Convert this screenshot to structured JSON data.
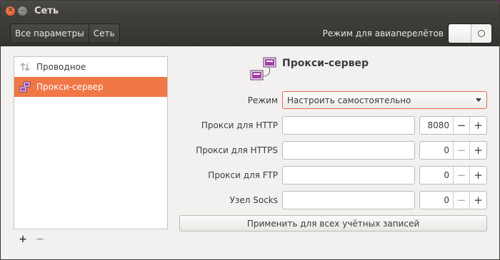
{
  "window": {
    "title": "Сеть"
  },
  "toolbar": {
    "breadcrumbs": [
      "Все параметры",
      "Сеть"
    ],
    "airplane_label": "Режим для авиаперелётов",
    "airplane_mode": "off"
  },
  "sidebar": {
    "items": [
      {
        "label": "Проводное",
        "icon": "wired-network-icon",
        "selected": false
      },
      {
        "label": "Прокси-сервер",
        "icon": "proxy-server-icon",
        "selected": true
      }
    ],
    "add_label": "+",
    "remove_label": "−"
  },
  "proxy": {
    "title": "Прокси-сервер",
    "mode_label": "Режим",
    "mode_value": "Настроить самостоятельно",
    "rows": [
      {
        "label": "Прокси для HTTP",
        "host": "",
        "port": "8080"
      },
      {
        "label": "Прокси для HTTPS",
        "host": "",
        "port": "0"
      },
      {
        "label": "Прокси для FTP",
        "host": "",
        "port": "0"
      },
      {
        "label": "Узел Socks",
        "host": "",
        "port": "0"
      }
    ],
    "stepper_minus": "−",
    "stepper_plus": "+",
    "apply_label": "Применить для всех учётных записей"
  },
  "colors": {
    "accent": "#f07746",
    "titlebar": "#3c3b37",
    "proxy_icon": "#a33faa"
  }
}
